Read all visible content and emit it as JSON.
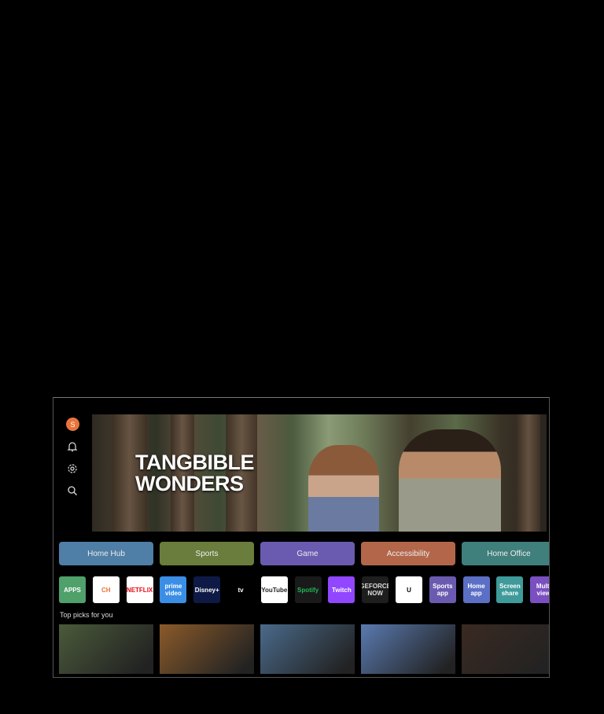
{
  "sidebar": {
    "avatar_letter": "S",
    "icons": [
      "bell-icon",
      "gear-icon",
      "search-icon"
    ]
  },
  "hero": {
    "title_line1": "TANGBIBLE",
    "title_line2": "WONDERS"
  },
  "categories": [
    {
      "label": "Home Hub",
      "color": "#4f7ea6"
    },
    {
      "label": "Sports",
      "color": "#6a7d3c"
    },
    {
      "label": "Game",
      "color": "#6a5bb0"
    },
    {
      "label": "Accessibility",
      "color": "#b3664a"
    },
    {
      "label": "Home Office",
      "color": "#3f7f7c"
    }
  ],
  "apps": [
    {
      "name": "APPS",
      "bg": "#4fa06a",
      "fg": "#fff"
    },
    {
      "name": "CH",
      "bg": "#ffffff",
      "fg": "#e8743b"
    },
    {
      "name": "NETFLIX",
      "bg": "#ffffff",
      "fg": "#e50914"
    },
    {
      "name": "prime video",
      "bg": "#3a8ee6",
      "fg": "#fff"
    },
    {
      "name": "Disney+",
      "bg": "#0e1a45",
      "fg": "#fff"
    },
    {
      "name": "tv",
      "bg": "#000000",
      "fg": "#fff"
    },
    {
      "name": "YouTube",
      "bg": "#ffffff",
      "fg": "#222"
    },
    {
      "name": "Spotify",
      "bg": "#1a1a1a",
      "fg": "#1db954"
    },
    {
      "name": "Twitch",
      "bg": "#9146ff",
      "fg": "#fff"
    },
    {
      "name": "GEFORCE NOW",
      "bg": "#1e1e1e",
      "fg": "#ddd"
    },
    {
      "name": "U",
      "bg": "#ffffff",
      "fg": "#000"
    },
    {
      "name": "Sports app",
      "bg": "#6a5bb0",
      "fg": "#fff"
    },
    {
      "name": "Home app",
      "bg": "#5b6fc4",
      "fg": "#fff"
    },
    {
      "name": "Screen share",
      "bg": "#3f9a9a",
      "fg": "#fff"
    },
    {
      "name": "Multi view",
      "bg": "#7a4fc0",
      "fg": "#fff"
    }
  ],
  "top_picks": {
    "label": "Top picks for you",
    "items": [
      "#4a5a3a",
      "#8a5a2a",
      "#4a6a8a",
      "#5a7ab0",
      "#3a2a22"
    ]
  }
}
